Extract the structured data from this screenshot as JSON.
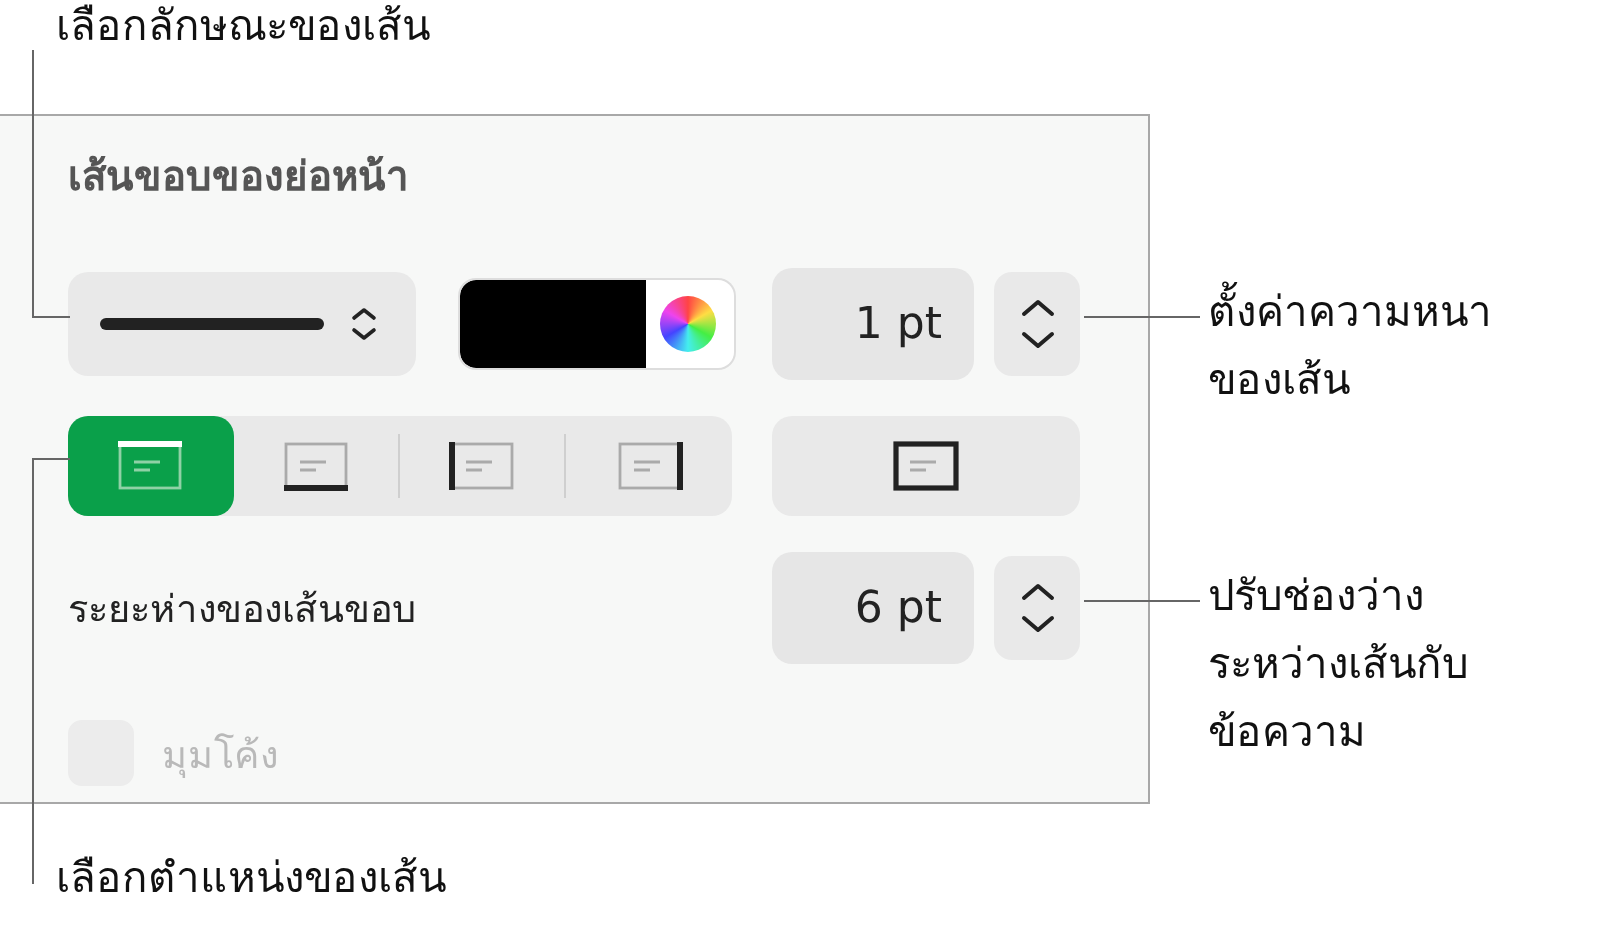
{
  "callouts": [
    {
      "kind": "style",
      "text": "เลือกลักษณะของเส้น"
    },
    {
      "kind": "thickness",
      "text": "ตั้งค่าความหนา\nของเส้น"
    },
    {
      "kind": "spacing",
      "text": "ปรับช่องว่าง\nระหว่างเส้นกับ\nข้อความ"
    },
    {
      "kind": "position",
      "text": "เลือกตำแหน่งของเส้น"
    }
  ],
  "panel": {
    "title": "เส้นขอบของย่อหน้า",
    "thickness": "1 pt",
    "positions": [
      {
        "kind": "top",
        "selected": true
      },
      {
        "kind": "bottom",
        "selected": false
      },
      {
        "kind": "left",
        "selected": false
      },
      {
        "kind": "right",
        "selected": false
      }
    ],
    "outline": {
      "kind": "all",
      "selected": false
    },
    "spacing_label": "ระยะห่างของเส้นขอบ",
    "spacing": "6 pt",
    "rounded": {
      "label": "มุมโค้ง",
      "checked": false,
      "disabled": true
    }
  }
}
